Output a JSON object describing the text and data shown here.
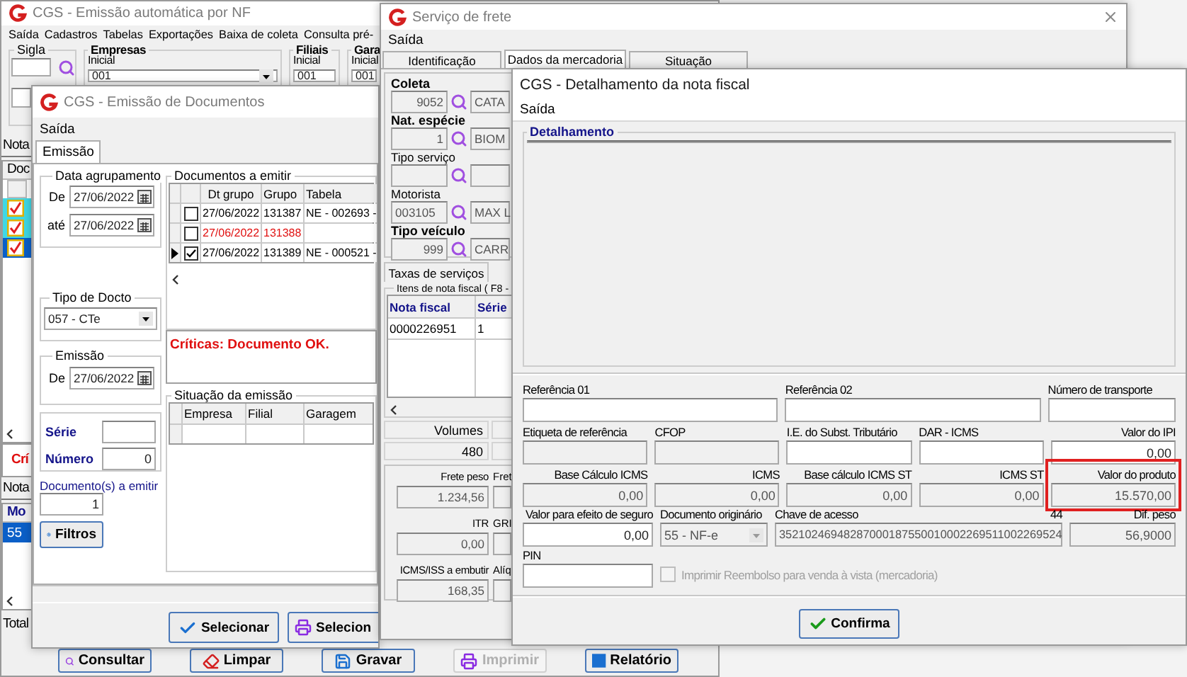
{
  "main_window": {
    "title": "CGS - Emissão automática por NF",
    "menu": [
      "Saída",
      "Cadastros",
      "Tabelas",
      "Exportações",
      "Baixa de coleta",
      "Consulta pré-"
    ],
    "filters": [
      {
        "kind": "lookup",
        "label": "Sigla"
      },
      {
        "kind": "select",
        "label": "Empresas",
        "sublabel": "Inicial",
        "value": "001"
      },
      {
        "kind": "field",
        "label": "Filiais",
        "sublabel": "Inicial",
        "value": "001"
      },
      {
        "kind": "field",
        "label": "Gara",
        "sublabel": "Inicial",
        "value": "001"
      }
    ],
    "documents_tab": "Nota",
    "documents_header": "Doc",
    "documents": [
      {
        "checked": true,
        "selected": false
      },
      {
        "checked": true,
        "selected": false
      },
      {
        "checked": true,
        "selected": true
      }
    ],
    "critique": "Crí",
    "notes_tab": "Nota",
    "notes_header": "Mo",
    "notes": [
      {
        "value": "55",
        "selected": true
      }
    ],
    "total_label": "Total",
    "buttons": [
      {
        "label": "Consultar",
        "disabled": false
      },
      {
        "label": "Limpar",
        "disabled": false
      },
      {
        "label": "Gravar",
        "disabled": false
      },
      {
        "label": "Imprimir",
        "disabled": true
      },
      {
        "label": "Relatório",
        "disabled": false
      }
    ]
  },
  "documents_window": {
    "title": "CGS - Emissão de Documentos",
    "menu": [
      "Saída"
    ],
    "tabs": [
      {
        "label": "Emissão",
        "selected": true
      }
    ],
    "grouping_date": {
      "title": "Data agrupamento",
      "from_label": "De",
      "from": "27/06/2022",
      "to_label": "até",
      "to": "27/06/2022"
    },
    "doc_type": {
      "title": "Tipo de Docto",
      "value": "057 - CTe"
    },
    "issue": {
      "title": "Emissão",
      "label": "De",
      "value": "27/06/2022"
    },
    "series_label": "Série",
    "number_label": "Número",
    "number": "0",
    "count_label": "Documento(s) a emitir",
    "count": "1",
    "filters_button": "Filtros",
    "documents": {
      "title": "Documentos a emitir",
      "columns": [
        "Dt grupo",
        "Grupo",
        "Tabela"
      ],
      "rows": [
        {
          "current": false,
          "checked": false,
          "error": false,
          "cells": [
            "27/06/2022",
            "131387",
            "NE - 002693 -"
          ]
        },
        {
          "current": false,
          "checked": false,
          "error": true,
          "cells": [
            "27/06/2022",
            "131388"
          ]
        },
        {
          "current": true,
          "checked": true,
          "error": false,
          "cells": [
            "27/06/2022",
            "131389",
            "NE - 000521 -"
          ]
        }
      ]
    },
    "critique": "Críticas: Documento OK.",
    "status": {
      "title": "Situação da emissão",
      "columns": [
        "Empresa",
        "Filial",
        "Garagem"
      ]
    },
    "buttons": [
      "Selecionar",
      "Selecion"
    ]
  },
  "freight_window": {
    "title": "Serviço de frete",
    "menu": [
      "Saída"
    ],
    "tabs": [
      {
        "label": "Identificação",
        "selected": false
      },
      {
        "label": "Dados da mercadoria",
        "selected": true
      },
      {
        "label": "Situação",
        "selected": false
      }
    ],
    "lookups": [
      {
        "label": "Coleta",
        "required": true,
        "code": "9052",
        "name": "CATA"
      },
      {
        "label": "Nat. espécie",
        "required": true,
        "code": "1",
        "name": "BIOM"
      },
      {
        "label": "Tipo serviço",
        "required": false
      },
      {
        "label": "Motorista",
        "required": false,
        "code": "003105",
        "name": "MAX L"
      },
      {
        "label": "Tipo veículo",
        "required": true,
        "code": "999",
        "name": "CARR"
      }
    ],
    "subtab": "Taxas de serviços",
    "items": {
      "title": "Itens de nota fiscal ( F8 -",
      "columns": [
        "Nota fiscal",
        "Série"
      ],
      "rows": [
        [
          "0000226951",
          "1"
        ]
      ]
    },
    "volumes": {
      "label": "Volumes",
      "value": "480"
    },
    "charges": [
      {
        "label": "Frete peso",
        "value": "1.234,56"
      },
      {
        "label": "ITR",
        "value": "0,00"
      },
      {
        "label": "ICMS/ISS a embutir",
        "value": "168,35"
      }
    ],
    "charges_side_labels": [
      "Fret",
      "GRI",
      "Alíq"
    ]
  },
  "detail_window": {
    "title": "CGS - Detalhamento da nota fiscal",
    "menu": [
      "Saída"
    ],
    "detail_title": "Detalhamento",
    "fields": [
      {
        "kind": "text",
        "label": "Referência 01",
        "editable": true
      },
      {
        "kind": "text",
        "label": "Referência 02",
        "editable": true
      },
      {
        "kind": "text",
        "label": "Número de transporte",
        "editable": true
      },
      {
        "kind": "text",
        "label": "Etiqueta de referência",
        "editable": false
      },
      {
        "kind": "text",
        "label": "CFOP",
        "editable": false
      },
      {
        "kind": "text",
        "label": "I.E. do Subst. Tributário",
        "editable": true
      },
      {
        "kind": "text",
        "label": "DAR - ICMS",
        "editable": true
      },
      {
        "kind": "number",
        "label": "Valor do IPI",
        "value": "0,00",
        "editable": true
      },
      {
        "kind": "number",
        "label": "Base Cálculo ICMS",
        "value": "0,00",
        "editable": false
      },
      {
        "kind": "number",
        "label": "ICMS",
        "value": "0,00",
        "editable": false
      },
      {
        "kind": "number",
        "label": "Base cálculo ICMS ST",
        "value": "0,00",
        "editable": false
      },
      {
        "kind": "number",
        "label": "ICMS ST",
        "value": "0,00",
        "editable": false
      },
      {
        "kind": "number",
        "label": "Valor do produto",
        "value": "15.570,00",
        "editable": false,
        "highlighted": true
      },
      {
        "kind": "number",
        "label": "Valor para efeito de seguro",
        "value": "0,00",
        "editable": true
      },
      {
        "kind": "select",
        "label": "Documento originário",
        "value": "55 - NF-e",
        "editable": false
      },
      {
        "kind": "key",
        "label": "Chave de acesso",
        "counter": "44",
        "value": "35210246948287000187550010002269511002269524",
        "editable": false
      },
      {
        "kind": "number",
        "label": "Dif. peso",
        "value": "56,9000",
        "editable": false
      },
      {
        "kind": "text",
        "label": "PIN",
        "editable": true
      },
      {
        "kind": "checkbox",
        "label": "Imprimir Reembolso para venda à vista (mercadoria)",
        "checked": false,
        "editable": false
      }
    ],
    "confirm_button": "Confirma"
  }
}
